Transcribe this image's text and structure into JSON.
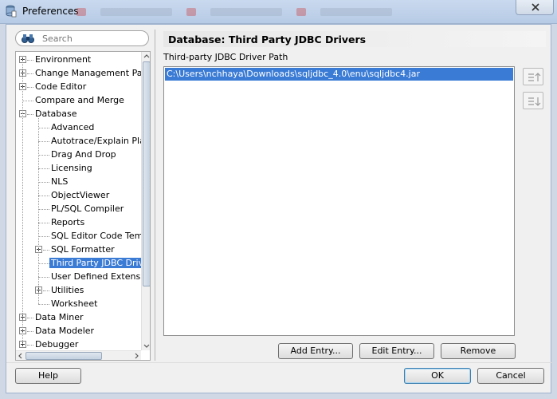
{
  "window": {
    "title": "Preferences"
  },
  "search": {
    "placeholder": "Search"
  },
  "tree": {
    "items": [
      {
        "label": "Environment",
        "level": 0,
        "expander": "plus"
      },
      {
        "label": "Change Management Param",
        "level": 0,
        "expander": "plus"
      },
      {
        "label": "Code Editor",
        "level": 0,
        "expander": "plus"
      },
      {
        "label": "Compare and Merge",
        "level": 0,
        "expander": "none"
      },
      {
        "label": "Database",
        "level": 0,
        "expander": "minus"
      },
      {
        "label": "Advanced",
        "level": 1,
        "expander": "none"
      },
      {
        "label": "Autotrace/Explain Plan",
        "level": 1,
        "expander": "none"
      },
      {
        "label": "Drag And Drop",
        "level": 1,
        "expander": "none"
      },
      {
        "label": "Licensing",
        "level": 1,
        "expander": "none"
      },
      {
        "label": "NLS",
        "level": 1,
        "expander": "none"
      },
      {
        "label": "ObjectViewer",
        "level": 1,
        "expander": "none"
      },
      {
        "label": "PL/SQL Compiler",
        "level": 1,
        "expander": "none"
      },
      {
        "label": "Reports",
        "level": 1,
        "expander": "none"
      },
      {
        "label": "SQL Editor Code Templa",
        "level": 1,
        "expander": "none"
      },
      {
        "label": "SQL Formatter",
        "level": 1,
        "expander": "plus"
      },
      {
        "label": "Third Party JDBC Driver",
        "level": 1,
        "expander": "none",
        "selected": true
      },
      {
        "label": "User Defined Extension",
        "level": 1,
        "expander": "none"
      },
      {
        "label": "Utilities",
        "level": 1,
        "expander": "plus"
      },
      {
        "label": "Worksheet",
        "level": 1,
        "expander": "none"
      },
      {
        "label": "Data Miner",
        "level": 0,
        "expander": "plus"
      },
      {
        "label": "Data Modeler",
        "level": 0,
        "expander": "plus"
      },
      {
        "label": "Debugger",
        "level": 0,
        "expander": "plus"
      }
    ]
  },
  "panel": {
    "title": "Database: Third Party JDBC Drivers",
    "path_label": "Third-party JDBC Driver Path",
    "paths": [
      "C:\\Users\\nchhaya\\Downloads\\sqljdbc_4.0\\enu\\sqljdbc4.jar"
    ],
    "buttons": {
      "add": "Add Entry...",
      "edit": "Edit Entry...",
      "remove": "Remove"
    }
  },
  "footer": {
    "help": "Help",
    "ok": "OK",
    "cancel": "Cancel"
  },
  "colors": {
    "selection": "#3a7bd5",
    "header_bg": "#e7e7e7"
  }
}
